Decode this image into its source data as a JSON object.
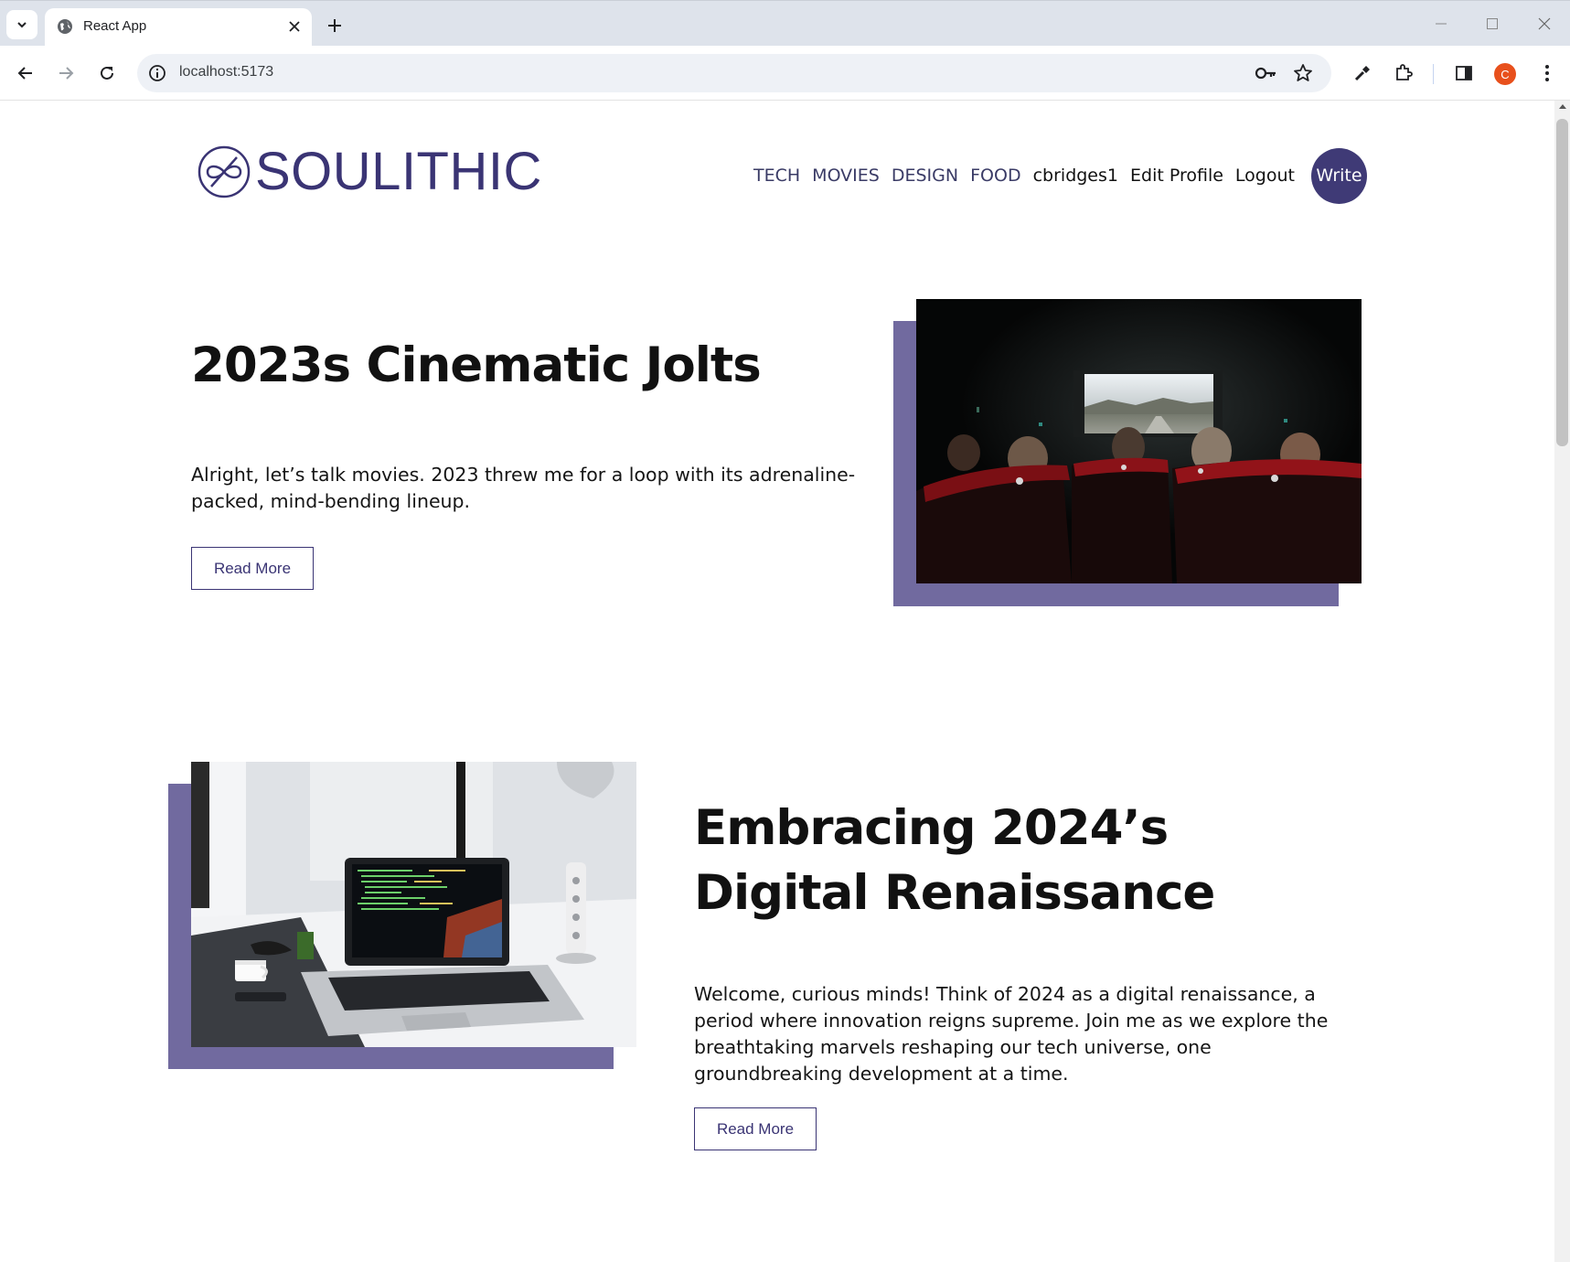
{
  "browser": {
    "tab_title": "React App",
    "url": "localhost:5173",
    "profile_initial": "C"
  },
  "site": {
    "logo_text": "SOULITHIC",
    "nav": {
      "categories": [
        "TECH",
        "MOVIES",
        "DESIGN",
        "FOOD"
      ],
      "username": "cbridges1",
      "edit_profile": "Edit Profile",
      "logout": "Logout",
      "write": "Write"
    },
    "accent_color": "#3f3a76",
    "image_shadow_color": "#716a9f"
  },
  "posts": [
    {
      "title": "2023s Cinematic Jolts",
      "description": "Alright, let’s talk movies. 2023 threw me for a loop with its adrenaline-packed, mind-bending lineup.",
      "button": "Read More",
      "image": "movie-theater-photo"
    },
    {
      "title": "Embracing 2024’s Digital Renaissance",
      "description": "Welcome, curious minds! Think of 2024 as a digital renaissance, a period where innovation reigns supreme. Join me as we explore the breathtaking marvels reshaping our tech universe, one groundbreaking development at a time.",
      "button": "Read More",
      "image": "laptop-desk-photo"
    }
  ]
}
